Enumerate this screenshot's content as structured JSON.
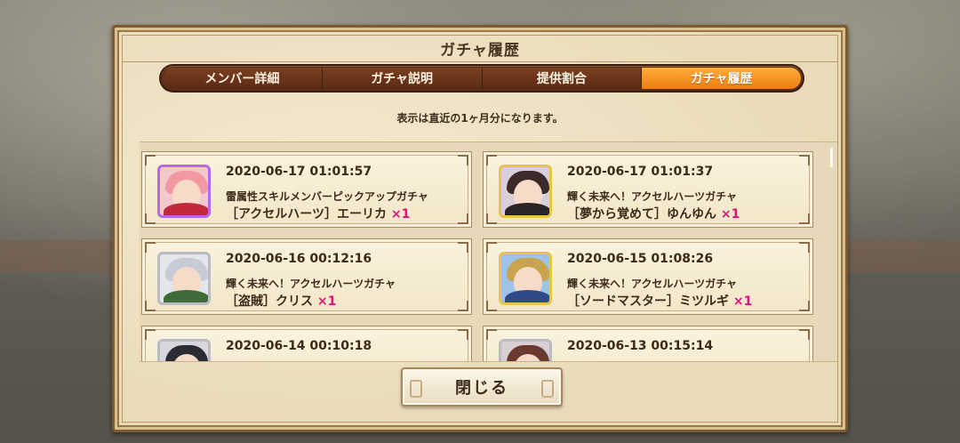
{
  "dialog": {
    "title": "ガチャ履歴",
    "notice": "表示は直近の1ヶ月分になります。",
    "close_label": "閉じる"
  },
  "tabs": [
    {
      "label": "メンバー詳細",
      "active": false
    },
    {
      "label": "ガチャ説明",
      "active": false
    },
    {
      "label": "提供割合",
      "active": false
    },
    {
      "label": "ガチャ履歴",
      "active": true
    }
  ],
  "history": [
    {
      "date": "2020-06-17 01:01:57",
      "gacha": "雷属性スキルメンバーピックアップガチャ",
      "member": "［アクセルハーツ］エーリカ",
      "qty": "×1",
      "frame": "purple"
    },
    {
      "date": "2020-06-17 01:01:37",
      "gacha": "輝く未来へ！アクセルハーツガチャ",
      "member": "［夢から覚めて］ゆんゆん",
      "qty": "×1",
      "frame": "gold"
    },
    {
      "date": "2020-06-16 00:12:16",
      "gacha": "輝く未来へ！アクセルハーツガチャ",
      "member": "［盗賊］クリス",
      "qty": "×1",
      "frame": "silver"
    },
    {
      "date": "2020-06-15 01:08:26",
      "gacha": "輝く未来へ！アクセルハーツガチャ",
      "member": "［ソードマスター］ミツルギ",
      "qty": "×1",
      "frame": "gold"
    },
    {
      "date": "2020-06-14 00:10:18",
      "gacha": "",
      "member": "",
      "qty": "",
      "frame": "silver"
    },
    {
      "date": "2020-06-13 00:15:14",
      "gacha": "",
      "member": "",
      "qty": "",
      "frame": "silver"
    }
  ],
  "colors": {
    "accent_tab": "#ee7c0e",
    "qty": "#e0117b"
  }
}
